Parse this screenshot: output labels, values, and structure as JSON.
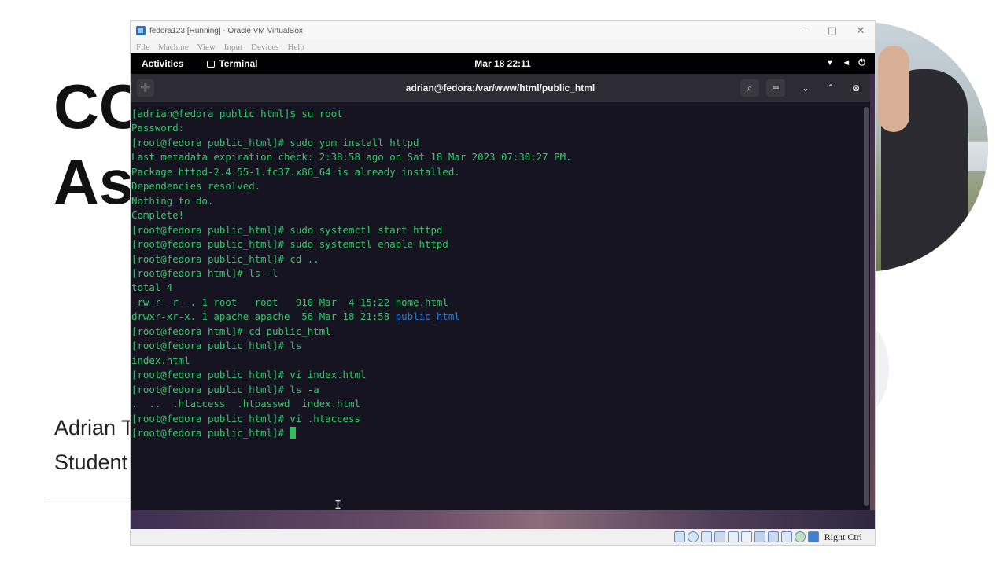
{
  "slide": {
    "title_line1": "CC",
    "title_line2": "As",
    "author_line1": "Adrian T",
    "author_line2": "Student"
  },
  "vbox": {
    "window_title": "fedora123 [Running] - Oracle VM VirtualBox",
    "menu": [
      "File",
      "Machine",
      "View",
      "Input",
      "Devices",
      "Help"
    ],
    "host_key": "Right Ctrl"
  },
  "gnome": {
    "activities": "Activities",
    "app_name": "Terminal",
    "clock": "Mar 18  22:11"
  },
  "terminal": {
    "title": "adrian@fedora:/var/www/html/public_html",
    "lines_before_dir": "[adrian@fedora public_html]$ su root\nPassword:\n[root@fedora public_html]# sudo yum install httpd\nLast metadata expiration check: 2:38:58 ago on Sat 18 Mar 2023 07:30:27 PM.\nPackage httpd-2.4.55-1.fc37.x86_64 is already installed.\nDependencies resolved.\nNothing to do.\nComplete!\n[root@fedora public_html]# sudo systemctl start httpd\n[root@fedora public_html]# sudo systemctl enable httpd\n[root@fedora public_html]# cd ..\n[root@fedora html]# ls -l\ntotal 4\n-rw-r--r--. 1 root   root   910 Mar  4 15:22 home.html\ndrwxr-xr-x. 1 apache apache  56 Mar 18 21:58 ",
    "dir_name": "public_html",
    "lines_after_dir": "\n[root@fedora html]# cd public_html\n[root@fedora public_html]# ls\nindex.html\n[root@fedora public_html]# vi index.html\n[root@fedora public_html]# ls -a\n.  ..  .htaccess  .htpasswd  index.html\n[root@fedora public_html]# vi .htaccess\n",
    "prompt": "[root@fedora public_html]# "
  }
}
